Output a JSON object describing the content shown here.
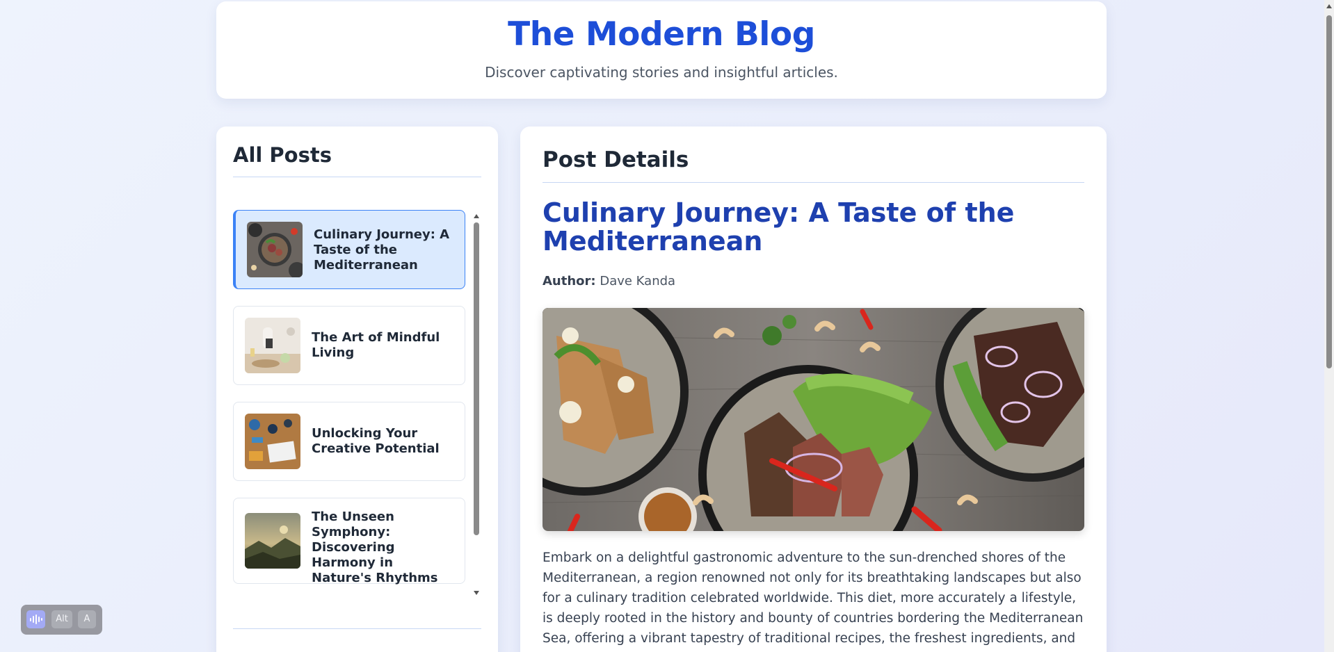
{
  "header": {
    "title": "The Modern Blog",
    "subtitle": "Discover captivating stories and insightful articles."
  },
  "sidebar": {
    "heading": "All Posts",
    "posts": [
      {
        "title": "Culinary Journey: A Taste of the Mediterranean",
        "active": true,
        "thumb": "mediterranean-food-icon"
      },
      {
        "title": "The Art of Mindful Living",
        "active": false,
        "thumb": "mindful-living-icon"
      },
      {
        "title": "Unlocking Your Creative Potential",
        "active": false,
        "thumb": "creative-desk-icon"
      },
      {
        "title": "The Unseen Symphony: Discovering Harmony in Nature's Rhythms",
        "active": false,
        "thumb": "nature-landscape-icon"
      }
    ]
  },
  "detail": {
    "heading": "Post Details",
    "title": "Culinary Journey: A Taste of the Mediterranean",
    "author_label": "Author:",
    "author_name": "Dave Kanda",
    "image": "mediterranean-dishes-photo",
    "body": "Embark on a delightful gastronomic adventure to the sun-drenched shores of the Mediterranean, a region renowned not only for its breathtaking landscapes but also for a culinary tradition celebrated worldwide. This diet, more accurately a lifestyle, is deeply rooted in the history and bounty of countries bordering the Mediterranean Sea, offering a vibrant tapestry of traditional recipes, the freshest ingredients, and a myriad of health"
  },
  "toolbar": {
    "wave_icon": "audio-wave-icon",
    "alt_label": "Alt",
    "a_label": "A"
  },
  "colors": {
    "brand": "#1d4ed8",
    "post_title": "#1e40af",
    "active_item_bg": "#dbeafe",
    "active_item_border": "#3b82f6"
  }
}
